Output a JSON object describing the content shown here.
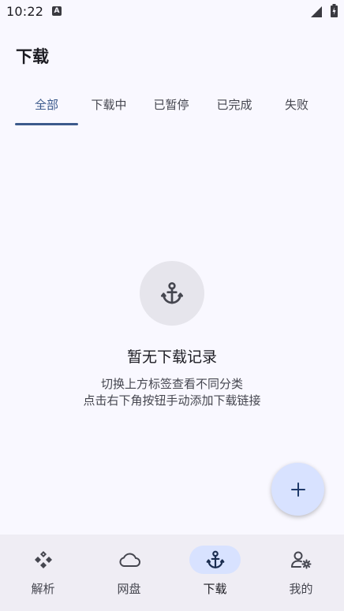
{
  "status_bar": {
    "time": "10:22",
    "notification_glyph": "A"
  },
  "top_bar": {
    "title": "下载"
  },
  "tabs": [
    {
      "label": "全部",
      "active": true
    },
    {
      "label": "下载中",
      "active": false
    },
    {
      "label": "已暂停",
      "active": false
    },
    {
      "label": "已完成",
      "active": false
    },
    {
      "label": "失败",
      "active": false
    }
  ],
  "empty_state": {
    "icon": "anchor-icon",
    "title": "暂无下载记录",
    "line1": "切换上方标签查看不同分类",
    "line2": "点击右下角按钮手动添加下载链接"
  },
  "fab": {
    "icon": "plus-icon"
  },
  "bottom_nav": [
    {
      "label": "解析",
      "icon": "parse-icon",
      "active": false
    },
    {
      "label": "网盘",
      "icon": "cloud-icon",
      "active": false
    },
    {
      "label": "下载",
      "icon": "anchor-icon",
      "active": true
    },
    {
      "label": "我的",
      "icon": "user-settings-icon",
      "active": false
    }
  ],
  "colors": {
    "accent": "#3c5a8c",
    "background": "#f9f8ff",
    "nav_background": "#efedf4",
    "pill": "#d8e2ff"
  }
}
